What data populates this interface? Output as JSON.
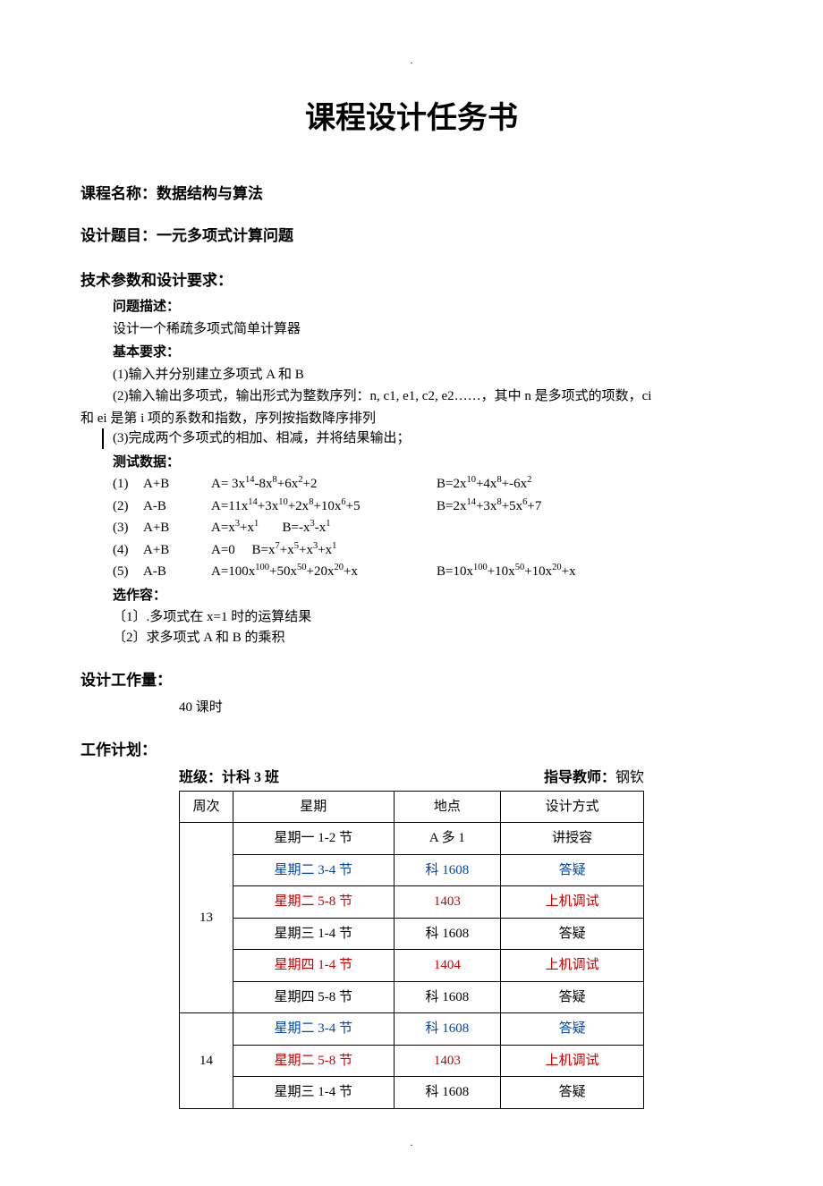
{
  "title": "课程设计任务书",
  "course": {
    "label": "课程名称：",
    "value": "数据结构与算法"
  },
  "topic": {
    "label": "设计题目：",
    "value": "一元多项式计算问题"
  },
  "tech": {
    "heading": "技术参数和设计要求：",
    "problem_label": "问题描述：",
    "problem_text": "设计一个稀疏多项式简单计算器",
    "basic_label": "基本要求：",
    "req1": "(1)输入并分别建立多项式 A 和 B",
    "req2a": "(2)输入输出多项式，输出形式为整数序列：n, c1, e1, c2, e2……，其中 n 是多项式的项数，ci",
    "req2b": "和 ei 是第 i 项的系数和指数，序列按指数降序排列",
    "req3": "(3)完成两个多项式的相加、相减，并将结果输出；",
    "test_label": "测试数据：",
    "tests": [
      {
        "idx": "(1)",
        "op": "A+B",
        "A_pre": "A= 3x",
        "A_html": "A= 3x<sup>14</sup>-8x<sup>8</sup>+6x<sup>2</sup>+2",
        "B_html": "B=2x<sup>10</sup>+4x<sup>8</sup>+-6x<sup>2</sup>"
      },
      {
        "idx": "(2)",
        "op": "A-B",
        "A_html": "A=11x<sup>14</sup>+3x<sup>10</sup>+2x<sup>8</sup>+10x<sup>6</sup>+5",
        "B_html": "B=2x<sup>14</sup>+3x<sup>8</sup>+5x<sup>6</sup>+7"
      },
      {
        "idx": "(3)",
        "op": "A+B",
        "A_html": "A=x<sup>3</sup>+x<sup>1</sup>&nbsp;&nbsp;&nbsp;&nbsp;&nbsp;&nbsp;&nbsp;B=-x<sup>3</sup>-x<sup>1</sup>",
        "B_html": ""
      },
      {
        "idx": "(4)",
        "op": "A+B",
        "A_html": "A=0&nbsp;&nbsp;&nbsp;&nbsp;&nbsp;B=x<sup>7</sup>+x<sup>5</sup>+x<sup>3</sup>+x<sup>1</sup>",
        "B_html": ""
      },
      {
        "idx": "(5)",
        "op": "A-B",
        "A_html": "A=100x<sup>100</sup>+50x<sup>50</sup>+20x<sup>20</sup>+x",
        "B_html": "B=10x<sup>100</sup>+10x<sup>50</sup>+10x<sup>20</sup>+x"
      }
    ],
    "opt_label": "选作容：",
    "opt1": "〔1〕.多项式在 x=1 时的运算结果",
    "opt2": "〔2〕求多项式 A 和 B 的乘积"
  },
  "work": {
    "heading": "设计工作量：",
    "hours": "40 课时"
  },
  "plan": {
    "heading": "工作计划：",
    "class_label": "班级：",
    "class_value": "计科 3 班",
    "teacher_label": "指导教师：",
    "teacher_value": "钢钦",
    "cols": {
      "week": "周次",
      "day": "星期",
      "loc": "地点",
      "mode": "设计方式"
    },
    "rows": [
      {
        "week": "13",
        "rowspan": 6,
        "day": "星期一 1-2 节",
        "loc": "A 多 1",
        "mode": "讲授容",
        "cls": ""
      },
      {
        "day": "星期二 3-4 节",
        "loc": "科 1608",
        "mode": "答疑",
        "cls": "blue"
      },
      {
        "day": "星期二 5-8 节",
        "loc": "1403",
        "mode": "上机调试",
        "cls": "red"
      },
      {
        "day": "星期三 1-4 节",
        "loc": "科 1608",
        "mode": "答疑",
        "cls": ""
      },
      {
        "day": "星期四 1-4 节",
        "loc": "1404",
        "mode": "上机调试",
        "cls": "red"
      },
      {
        "day": "星期四 5-8 节",
        "loc": "科 1608",
        "mode": "答疑",
        "cls": ""
      },
      {
        "week": "14",
        "rowspan": 3,
        "day": "星期二 3-4 节",
        "loc": "科 1608",
        "mode": "答疑",
        "cls": "blue"
      },
      {
        "day": "星期二 5-8 节",
        "loc": "1403",
        "mode": "上机调试",
        "cls": "red"
      },
      {
        "day": "星期三 1-4 节",
        "loc": "科 1608",
        "mode": "答疑",
        "cls": ""
      }
    ]
  },
  "dot": "."
}
